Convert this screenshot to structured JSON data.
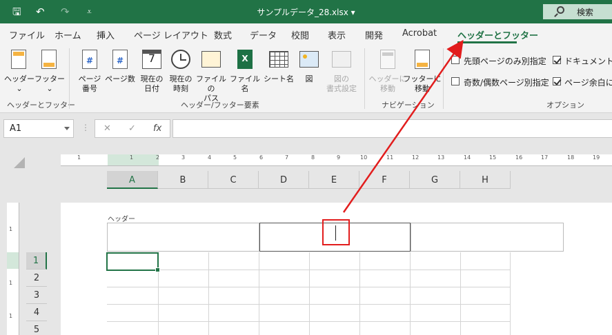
{
  "titlebar": {
    "doc_title": "サンプルデータ_28.xlsx  ▾",
    "search_label": "検索",
    "undo_glyph": "↶",
    "redo_glyph": "↷",
    "save_glyph": "🖫",
    "customize_glyph": "⩡"
  },
  "tabs": [
    {
      "label": "ファイル"
    },
    {
      "label": "ホーム"
    },
    {
      "label": "挿入"
    },
    {
      "label": "ページ レイアウト"
    },
    {
      "label": "数式"
    },
    {
      "label": "データ"
    },
    {
      "label": "校閲"
    },
    {
      "label": "表示"
    },
    {
      "label": "開発"
    },
    {
      "label": "Acrobat"
    },
    {
      "label": "ヘッダーとフッター"
    }
  ],
  "ribbon": {
    "groups": {
      "hf": "ヘッダーとフッター",
      "elements": "ヘッダー/フッター要素",
      "navigation": "ナビゲーション",
      "options": "オプション"
    },
    "header_btn": "ヘッダー",
    "footer_btn": "フッター",
    "dropdown_glyph": "⌄",
    "page_number": "ページ\n番号",
    "page_count": "ページ数",
    "current_date": "現在の\n日付",
    "current_time": "現在の\n時刻",
    "file_path": "ファイルの\nパス",
    "file_name": "ファイル名",
    "sheet_name": "シート名",
    "picture": "図",
    "format_picture": "図の\n書式設定",
    "goto_header": "ヘッダーに\n移動",
    "goto_footer": "フッターに\n移動",
    "calendar_num": "7",
    "options": {
      "different_first": "先頭ページのみ別指定",
      "different_odd_even": "奇数/偶数ページ別指定",
      "scale_with_doc": "ドキュメントに合",
      "align_margins": "ページ余白に合"
    }
  },
  "formula_bar": {
    "name_box": "A1",
    "cancel_glyph": "✕",
    "enter_glyph": "✓",
    "fx_glyph": "fx",
    "more_glyph": "⋮",
    "formula": ""
  },
  "sheet": {
    "columns": [
      "A",
      "B",
      "C",
      "D",
      "E",
      "F",
      "G",
      "H"
    ],
    "rows": [
      "1",
      "2",
      "3",
      "4",
      "5"
    ],
    "ruler_ticks": [
      "1",
      "1",
      "2",
      "3",
      "4",
      "5",
      "6",
      "7",
      "8",
      "9",
      "10",
      "11",
      "12",
      "13",
      "14",
      "15",
      "16",
      "17",
      "18",
      "19"
    ],
    "header_label": "ヘッダー",
    "vruler_ticks": [
      "1",
      "1",
      "1"
    ]
  }
}
